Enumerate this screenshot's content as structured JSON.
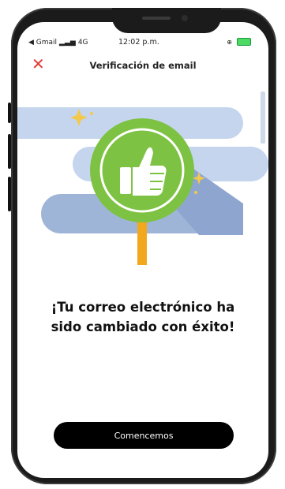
{
  "status_bar": {
    "back_app": "◀ Gmail",
    "network": "4G",
    "time": "12:02 p.m."
  },
  "header": {
    "close_icon": "close-icon",
    "title": "Verificación de email"
  },
  "illustration": {
    "icon": "thumbs-up-icon",
    "colors": {
      "green": "#7dc242",
      "blue_light": "#c5d5ee",
      "blue_dark": "#9fb5d8",
      "pole": "#f2a81d"
    }
  },
  "message": {
    "line1": "¡Tu correo electrónico ha",
    "line2": "sido cambiado con éxito!"
  },
  "cta": {
    "label": "Comencemos"
  }
}
